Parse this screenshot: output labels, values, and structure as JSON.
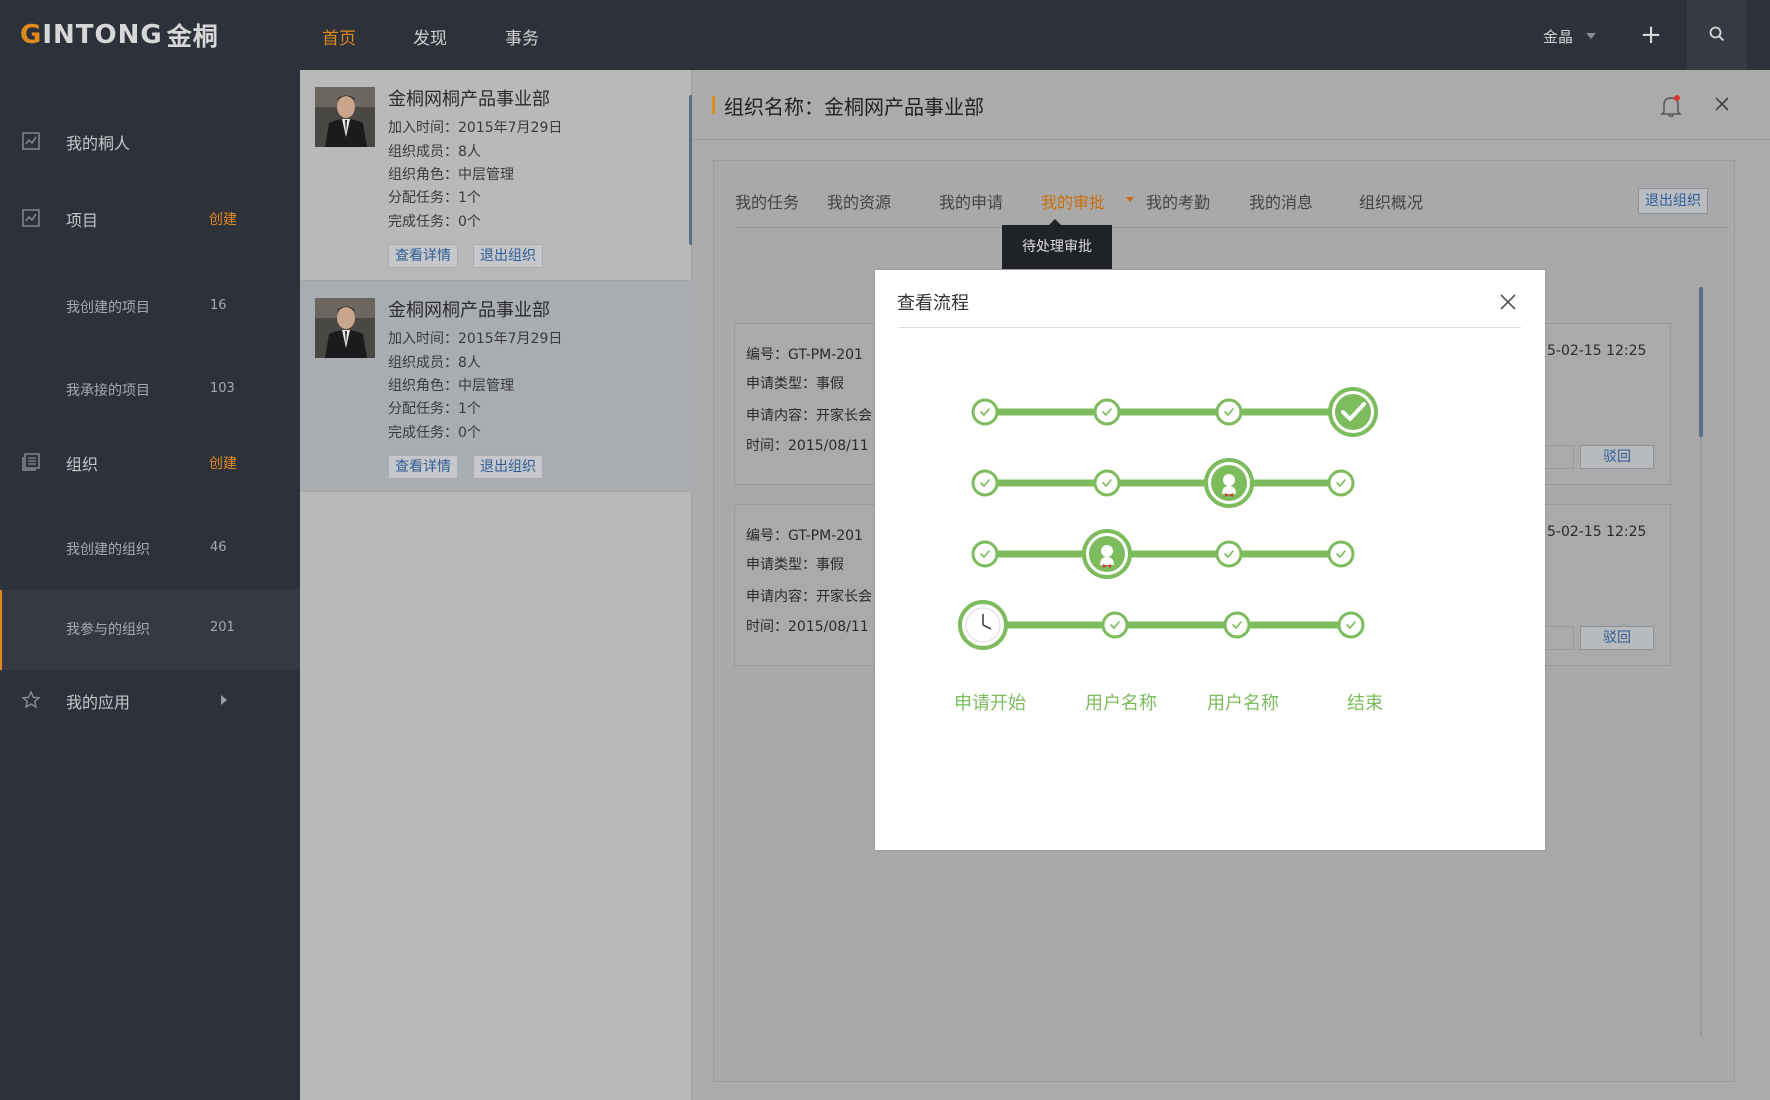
{
  "logo": {
    "g": "G",
    "rest": "INTONG",
    "cn": "金桐"
  },
  "nav": {
    "items": [
      {
        "label": "首页",
        "active": true
      },
      {
        "label": "发现",
        "active": false
      },
      {
        "label": "事务",
        "active": false
      }
    ]
  },
  "user": {
    "name": "金晶"
  },
  "icons": {
    "plus": "+",
    "search": "search-icon",
    "bell": "bell-icon",
    "close": "close-icon"
  },
  "colors": {
    "accent": "#e08a1e",
    "success": "#7cbc5c",
    "link": "#2f5e96"
  },
  "sidebar": {
    "items": [
      {
        "label": "我的桐人",
        "icon": "contacts-icon"
      },
      {
        "label": "项目",
        "action": "创建",
        "icon": "project-icon"
      },
      {
        "label": "我创建的项目",
        "count": "16"
      },
      {
        "label": "我承接的项目",
        "count": "103"
      },
      {
        "label": "组织",
        "action": "创建",
        "icon": "organization-icon"
      },
      {
        "label": "我创建的组织",
        "count": "46"
      },
      {
        "label": "我参与的组织",
        "count": "201",
        "selected": true
      },
      {
        "label": "我的应用",
        "icon": "star-icon"
      }
    ]
  },
  "orgs": [
    {
      "name": "金桐网桐产品事业部",
      "joined": "加入时间：2015年7月29日",
      "members": "组织成员：8人",
      "role": "组织角色：中层管理",
      "assigned": "分配任务：1个",
      "completed": "完成任务：0个",
      "view_label": "查看详情",
      "exit_label": "退出组织"
    },
    {
      "name": "金桐网桐产品事业部",
      "joined": "加入时间：2015年7月29日",
      "members": "组织成员：8人",
      "role": "组织角色：中层管理",
      "assigned": "分配任务：1个",
      "completed": "完成任务：0个",
      "view_label": "查看详情",
      "exit_label": "退出组织"
    }
  ],
  "detail": {
    "title": "组织名称：金桐网产品事业部",
    "tabs": [
      {
        "label": "我的任务"
      },
      {
        "label": "我的资源"
      },
      {
        "label": "我的申请"
      },
      {
        "label": "我的审批",
        "active": true
      },
      {
        "label": "我的考勤"
      },
      {
        "label": "我的消息"
      },
      {
        "label": "组织概况"
      }
    ],
    "exit_label": "退出组织",
    "tooltip": "待处理审批",
    "approvals": [
      {
        "number": "编号：GT-PM-201",
        "type": "申请类型：事假",
        "content": "申请内容：开家长会",
        "time": "时间：2015/08/11",
        "date": "5-02-15  12:25",
        "reject_label": "驳回"
      },
      {
        "number": "编号：GT-PM-201",
        "type": "申请类型：事假",
        "content": "申请内容：开家长会",
        "time": "时间：2015/08/11",
        "date": "5-02-15  12:25",
        "reject_label": "驳回"
      }
    ]
  },
  "modal": {
    "title": "查看流程",
    "steps": [
      "申请开始",
      "用户名称",
      "用户名称",
      "结束"
    ],
    "flows": [
      {
        "current_step": 4,
        "status": "completed"
      },
      {
        "current_step": 3,
        "status": "in-progress"
      },
      {
        "current_step": 2,
        "status": "in-progress"
      },
      {
        "current_step": 1,
        "status": "pending"
      }
    ]
  }
}
